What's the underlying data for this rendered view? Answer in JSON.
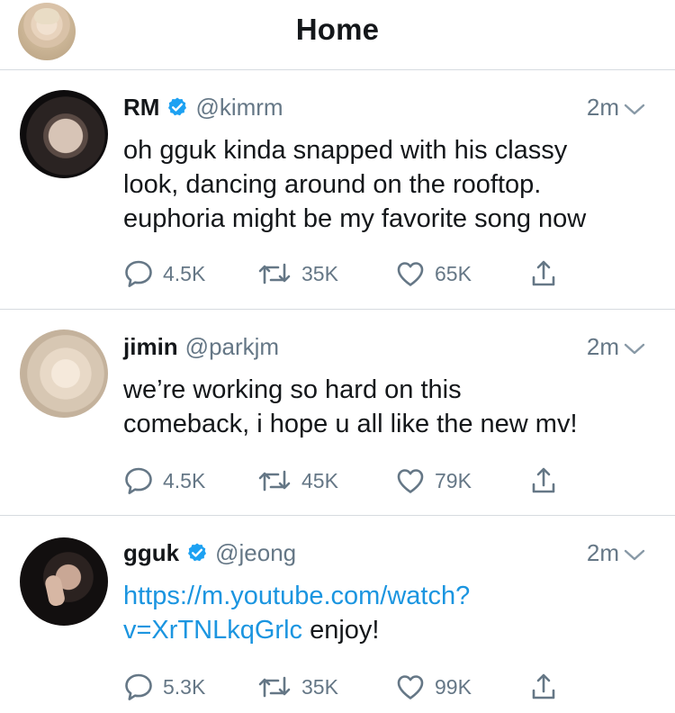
{
  "header": {
    "title": "Home"
  },
  "tweets": [
    {
      "name": "RM",
      "verified": true,
      "handle": "@kimrm",
      "time": "2m",
      "text_lines": [
        "oh gguk kinda snapped with his classy",
        "look, dancing around on the rooftop.",
        "euphoria might be my favorite song now"
      ],
      "replies": "4.5K",
      "retweets": "35K",
      "likes": "65K"
    },
    {
      "name": "jimin",
      "verified": false,
      "handle": "@parkjm",
      "time": "2m",
      "text_lines": [
        "we’re working so hard on this",
        "comeback, i hope u all like the new mv!"
      ],
      "replies": "4.5K",
      "retweets": "45K",
      "likes": "79K"
    },
    {
      "name": "gguk",
      "verified": true,
      "handle": "@jeong",
      "time": "2m",
      "link_line_1": "https://m.youtube.com/watch?",
      "link_line_2": "v=XrTNLkqGrlc",
      "text_after_link": " enjoy!",
      "replies": "5.3K",
      "retweets": "35K",
      "likes": "99K"
    }
  ],
  "colors": {
    "verified_blue": "#1da1f2",
    "link_blue": "#1b95e0",
    "secondary_gray": "#657786",
    "divider": "#d6dbe0"
  },
  "icons": {
    "reply": "reply-icon",
    "retweet": "retweet-icon",
    "like": "heart-icon",
    "share": "share-icon",
    "verified": "verified-badge-icon",
    "caret": "chevron-down-icon"
  }
}
